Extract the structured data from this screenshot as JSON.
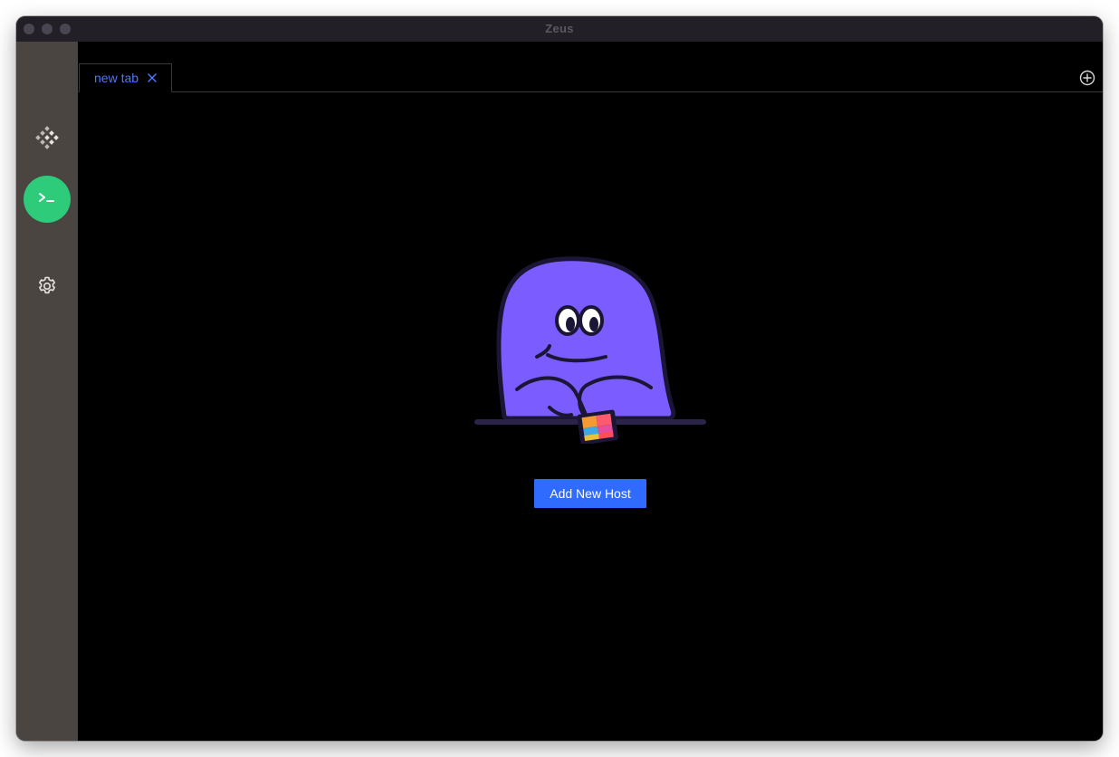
{
  "window": {
    "title": "Zeus"
  },
  "sidebar": {
    "items": [
      {
        "name": "hosts",
        "icon": "diamond-grid-icon"
      },
      {
        "name": "terminal",
        "icon": "terminal-icon",
        "active": true,
        "color": "#2ecc7a"
      },
      {
        "name": "settings",
        "icon": "gear-icon"
      }
    ]
  },
  "tabs": [
    {
      "label": "new tab",
      "close_icon": "close-icon"
    }
  ],
  "toolbar": {
    "new_tab_icon": "plus-circle-icon"
  },
  "main": {
    "illustration": "purple-blob-mascot-with-phone",
    "add_host_label": "Add New Host"
  },
  "colors": {
    "accent": "#2f6bff",
    "tab_text": "#4a78ff",
    "sidebar_bg": "#4a4540",
    "terminal_active": "#2ecc7a",
    "mascot": "#7b5cff"
  }
}
